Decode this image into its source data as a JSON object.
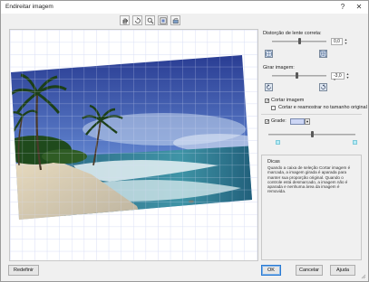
{
  "window": {
    "title": "Endireitar imagem"
  },
  "toolbar": {
    "tools": [
      {
        "name": "pan-hand-icon"
      },
      {
        "name": "rotate-back-icon"
      },
      {
        "name": "zoom-icon"
      },
      {
        "name": "fit-view-icon"
      },
      {
        "name": "rotate-image-icon"
      }
    ]
  },
  "panel": {
    "lens_label": "Distorção de lente correta:",
    "lens_value": "0,0",
    "lens_level": 0.5,
    "rotate_label": "Girar imagem:",
    "rotate_value": "-3,0 °",
    "rotate_level": 0.46,
    "crop_label": "Cortar imagem",
    "crop_checked": true,
    "crop_resample_label": "Cortar e reamostrar no tamanho original",
    "crop_resample_checked": false,
    "grid_label": "Grade:",
    "grid_checked": true,
    "grid_color": "#cdd6f5",
    "grid_level": 0.5
  },
  "tips": {
    "title": "Dicas",
    "text": "Quando a caixa de seleção Cortar imagem é marcada, a imagem girada é aparada para manter sua proporção original. Quando o controle está desmarcado, a imagem não é aparada e nenhuma área da imagem é removida."
  },
  "buttons": {
    "reset": "Redefinir",
    "ok": "OK",
    "cancel": "Cancelar",
    "help": "Ajuda"
  }
}
